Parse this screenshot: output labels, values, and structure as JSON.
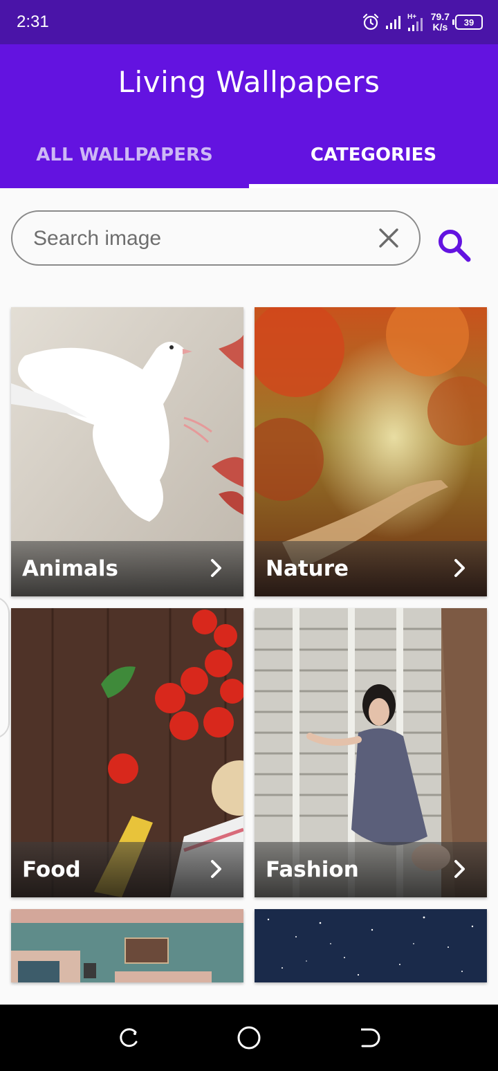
{
  "status_bar": {
    "time": "2:31",
    "net_speed_value": "79.7",
    "net_speed_unit": "K/s",
    "battery": "39",
    "network_type": "H+",
    "icons": [
      "alarm-icon",
      "signal-icon",
      "signal-h-plus-icon",
      "battery-icon"
    ]
  },
  "app_bar": {
    "title": "Living Wallpapers",
    "tabs": [
      {
        "label": "ALL WALLPAPERS",
        "selected": false
      },
      {
        "label": "CATEGORIES",
        "selected": true
      }
    ],
    "color": "#6313e0",
    "status_color": "#4a14a8"
  },
  "search": {
    "placeholder": "Search image",
    "value": "",
    "clear_icon": "close-icon",
    "search_icon": "search-icon",
    "accent": "#6313e0"
  },
  "categories": [
    {
      "label": "Animals"
    },
    {
      "label": "Nature"
    },
    {
      "label": "Food"
    },
    {
      "label": "Fashion"
    },
    {
      "label": ""
    },
    {
      "label": ""
    }
  ],
  "nav_bar": {
    "icons": [
      "recent-apps-icon",
      "home-icon",
      "back-icon"
    ]
  }
}
